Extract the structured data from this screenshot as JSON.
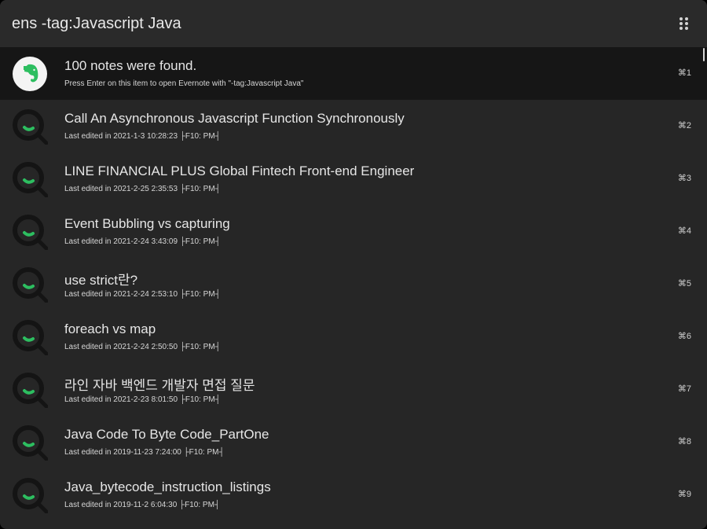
{
  "search": {
    "query": "ens -tag:Javascript Java"
  },
  "colors": {
    "accent_green": "#2dbe60",
    "background": "#262626",
    "selected_row": "#161616"
  },
  "icons": {
    "menu": "grid-dots-icon",
    "first_result": "evernote-logo-icon",
    "note_result": "search-magnifier-icon"
  },
  "results": [
    {
      "title": "100 notes were found.",
      "subtitle": "Press Enter on this item to open Evernote with \"-tag:Javascript Java\"",
      "shortcut": "⌘1"
    },
    {
      "title": "Call An Asynchronous Javascript Function Synchronously",
      "subtitle": "Last edited in 2021-1-3 10:28:23 ├F10: PM┤",
      "shortcut": "⌘2"
    },
    {
      "title": "LINE FINANCIAL PLUS Global Fintech Front-end Engineer",
      "subtitle": "Last edited in 2021-2-25 2:35:53 ├F10: PM┤",
      "shortcut": "⌘3"
    },
    {
      "title": "Event Bubbling vs capturing",
      "subtitle": "Last edited in 2021-2-24 3:43:09 ├F10: PM┤",
      "shortcut": "⌘4"
    },
    {
      "title": "use strict란?",
      "subtitle": "Last edited in 2021-2-24 2:53:10 ├F10: PM┤",
      "shortcut": "⌘5"
    },
    {
      "title": "foreach vs map",
      "subtitle": "Last edited in 2021-2-24 2:50:50 ├F10: PM┤",
      "shortcut": "⌘6"
    },
    {
      "title": "라인 자바 백엔드 개발자 면접 질문",
      "subtitle": "Last edited in 2021-2-23 8:01:50 ├F10: PM┤",
      "shortcut": "⌘7"
    },
    {
      "title": "Java Code To Byte Code_PartOne",
      "subtitle": "Last edited in 2019-11-23 7:24:00 ├F10: PM┤",
      "shortcut": "⌘8"
    },
    {
      "title": "Java_bytecode_instruction_listings",
      "subtitle": "Last edited in 2019-11-2 6:04:30 ├F10: PM┤",
      "shortcut": "⌘9"
    }
  ]
}
